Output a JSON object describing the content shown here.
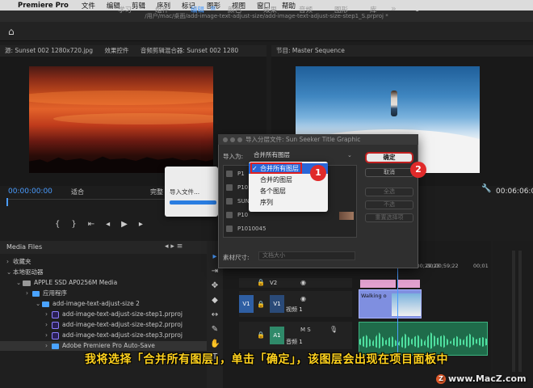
{
  "menubar": {
    "app": "Premiere Pro",
    "items": [
      "文件",
      "编辑",
      "剪辑",
      "序列",
      "标记",
      "图形",
      "视图",
      "窗口",
      "帮助"
    ]
  },
  "titlebar": {
    "path": "/用户/mac/桌面/add-image-text-adjust-size/add-image-text-adjust-size-step1_S.prproj *"
  },
  "workspaces": {
    "items": [
      "学习",
      "组件",
      "编辑",
      "颜色",
      "效果",
      "音频",
      "图形",
      "库"
    ],
    "active": "编辑"
  },
  "source_panel": {
    "tabs": [
      "源: Sunset 002 1280x720.jpg",
      "效果控件",
      "音频剪辑混合器: Sunset 002 1280"
    ],
    "timecode": "00:00:00:00",
    "fit": "适合",
    "full": "完整"
  },
  "program_panel": {
    "title": "节目: Master Sequence",
    "timecode": "00:06:06:08"
  },
  "project_panel": {
    "title": "Media Files",
    "rows": [
      {
        "label": "收藏夹",
        "type": "group"
      },
      {
        "label": "本地驱动器",
        "type": "group"
      },
      {
        "label": "APPLE SSD AP0256M Media",
        "type": "drive"
      },
      {
        "label": "应用程序",
        "type": "folder"
      },
      {
        "label": "add-image-text-adjust-size 2",
        "type": "folder"
      },
      {
        "label": "add-image-text-adjust-size-step1.prproj",
        "type": "prproj"
      },
      {
        "label": "add-image-text-adjust-size-step2.prproj",
        "type": "prproj"
      },
      {
        "label": "add-image-text-adjust-size-step3.prproj",
        "type": "prproj"
      },
      {
        "label": "Adobe Premiere Pro Auto-Save",
        "type": "folder"
      }
    ]
  },
  "timeline": {
    "timecodes": [
      "00;00;29;23",
      "00;00;59;22",
      "00;01"
    ],
    "tracks": [
      {
        "name": "V2",
        "label": ""
      },
      {
        "name": "V1",
        "label": "视频 1"
      },
      {
        "name": "A1",
        "label": "音频 1"
      }
    ],
    "clip_label": "Walking o"
  },
  "import_box": {
    "label": "导入文件..."
  },
  "dialog": {
    "title": "导入分层文件: Sun Seeker Title Graphic",
    "import_as_label": "导入为:",
    "import_as_value": "合并所有图层",
    "ok": "确定",
    "cancel": "取消",
    "side_buttons": [
      "全选",
      "不选",
      "重置选择项"
    ],
    "layers": [
      "P1",
      "P10",
      "SUN",
      "P10",
      "P1010045"
    ],
    "footage_size_label": "素材尺寸:",
    "footage_size_value": "文档大小"
  },
  "dropdown": {
    "items": [
      "合并所有图层",
      "合并的图层",
      "各个图层",
      "序列"
    ],
    "selected": "合并所有图层"
  },
  "callouts": [
    "1",
    "2"
  ],
  "subtitle": "我将选择「合并所有图层」，单击「确定」，该图层会出现在项目面板中",
  "watermark": "www.MacZ.com",
  "colors": {
    "accent": "#4a9cff",
    "callout": "#e02a2a",
    "subtitle": "#ffd21e"
  }
}
